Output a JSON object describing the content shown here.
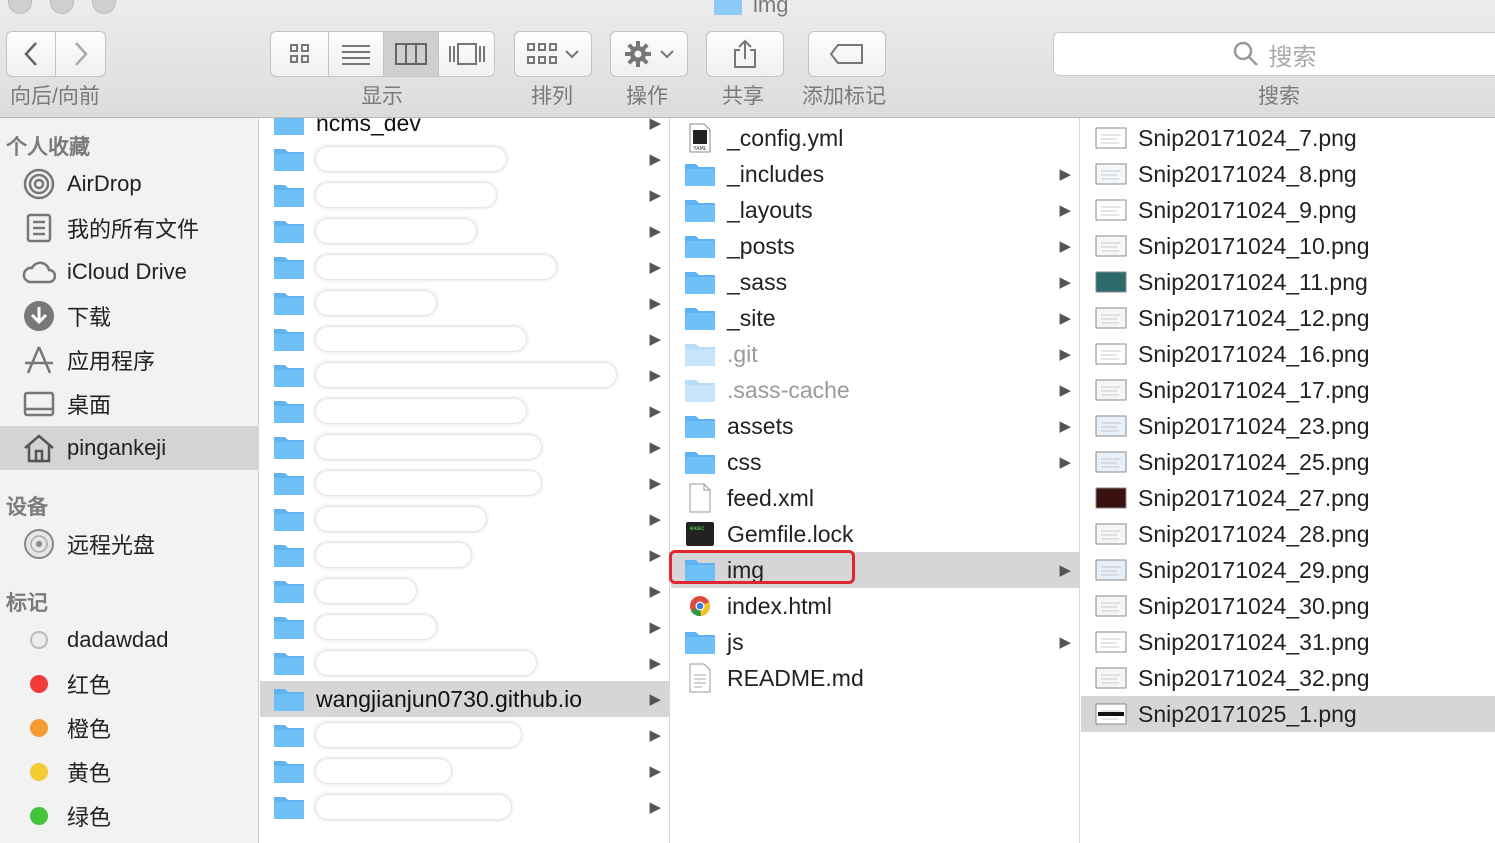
{
  "window": {
    "title": "img"
  },
  "toolbar": {
    "nav_label": "向后/向前",
    "view_label": "显示",
    "arrange_label": "排列",
    "action_label": "操作",
    "share_label": "共享",
    "tags_label": "添加标记",
    "search_placeholder": "搜索",
    "search_label": "搜索"
  },
  "sidebar": {
    "favorites_header": "个人收藏",
    "favorites": [
      {
        "label": "AirDrop",
        "icon": "airdrop-icon"
      },
      {
        "label": "我的所有文件",
        "icon": "all-files-icon"
      },
      {
        "label": "iCloud Drive",
        "icon": "cloud-icon"
      },
      {
        "label": "下载",
        "icon": "download-icon"
      },
      {
        "label": "应用程序",
        "icon": "applications-icon"
      },
      {
        "label": "桌面",
        "icon": "desktop-icon"
      },
      {
        "label": "pingankeji",
        "icon": "home-icon"
      }
    ],
    "devices_header": "设备",
    "devices": [
      {
        "label": "远程光盘",
        "icon": "disc-icon"
      }
    ],
    "tags_header": "标记",
    "tags": [
      {
        "label": "dadawdad",
        "color": "#d9d9d9"
      },
      {
        "label": "红色",
        "color": "#f23c3c"
      },
      {
        "label": "橙色",
        "color": "#f59a32"
      },
      {
        "label": "黄色",
        "color": "#f5cc32"
      },
      {
        "label": "绿色",
        "color": "#43c43c"
      }
    ]
  },
  "column1": {
    "items": [
      {
        "name": "ncms_dev"
      },
      {
        "name": ""
      },
      {
        "name": ""
      },
      {
        "name": ""
      },
      {
        "name": ""
      },
      {
        "name": ""
      },
      {
        "name": ""
      },
      {
        "name": ""
      },
      {
        "name": ""
      },
      {
        "name": ""
      },
      {
        "name": ""
      },
      {
        "name": ""
      },
      {
        "name": ""
      },
      {
        "name": ""
      },
      {
        "name": ""
      },
      {
        "name": ""
      },
      {
        "name": "wangjianjun0730.github.io"
      },
      {
        "name": ""
      },
      {
        "name": ""
      },
      {
        "name": ""
      }
    ]
  },
  "column2": {
    "items": [
      {
        "name": "_config.yml",
        "kind": "yaml-file-icon",
        "folder": false
      },
      {
        "name": "_includes",
        "kind": "folder-icon",
        "folder": true
      },
      {
        "name": "_layouts",
        "kind": "folder-icon",
        "folder": true
      },
      {
        "name": "_posts",
        "kind": "folder-icon",
        "folder": true
      },
      {
        "name": "_sass",
        "kind": "folder-icon",
        "folder": true
      },
      {
        "name": "_site",
        "kind": "folder-icon",
        "folder": true
      },
      {
        "name": ".git",
        "kind": "folder-icon",
        "folder": true
      },
      {
        "name": ".sass-cache",
        "kind": "folder-icon",
        "folder": true
      },
      {
        "name": "assets",
        "kind": "folder-icon",
        "folder": true
      },
      {
        "name": "css",
        "kind": "folder-icon",
        "folder": true
      },
      {
        "name": "feed.xml",
        "kind": "file-icon",
        "folder": false
      },
      {
        "name": "Gemfile.lock",
        "kind": "terminal-file-icon",
        "folder": false
      },
      {
        "name": "img",
        "kind": "folder-icon",
        "folder": true
      },
      {
        "name": "index.html",
        "kind": "chrome-html-icon",
        "folder": false
      },
      {
        "name": "js",
        "kind": "folder-icon",
        "folder": true
      },
      {
        "name": "README.md",
        "kind": "text-file-icon",
        "folder": false
      }
    ]
  },
  "column3": {
    "items": [
      {
        "name": "Snip20171024_7.png"
      },
      {
        "name": "Snip20171024_8.png"
      },
      {
        "name": "Snip20171024_9.png"
      },
      {
        "name": "Snip20171024_10.png"
      },
      {
        "name": "Snip20171024_11.png"
      },
      {
        "name": "Snip20171024_12.png"
      },
      {
        "name": "Snip20171024_16.png"
      },
      {
        "name": "Snip20171024_17.png"
      },
      {
        "name": "Snip20171024_23.png"
      },
      {
        "name": "Snip20171024_25.png"
      },
      {
        "name": "Snip20171024_27.png"
      },
      {
        "name": "Snip20171024_28.png"
      },
      {
        "name": "Snip20171024_29.png"
      },
      {
        "name": "Snip20171024_30.png"
      },
      {
        "name": "Snip20171024_31.png"
      },
      {
        "name": "Snip20171024_32.png"
      },
      {
        "name": "Snip20171025_1.png"
      }
    ]
  },
  "colors": {
    "folder_blue": "#5fb3f3",
    "selection_gray": "#d6d6d6",
    "highlight_red": "#e0262f"
  }
}
